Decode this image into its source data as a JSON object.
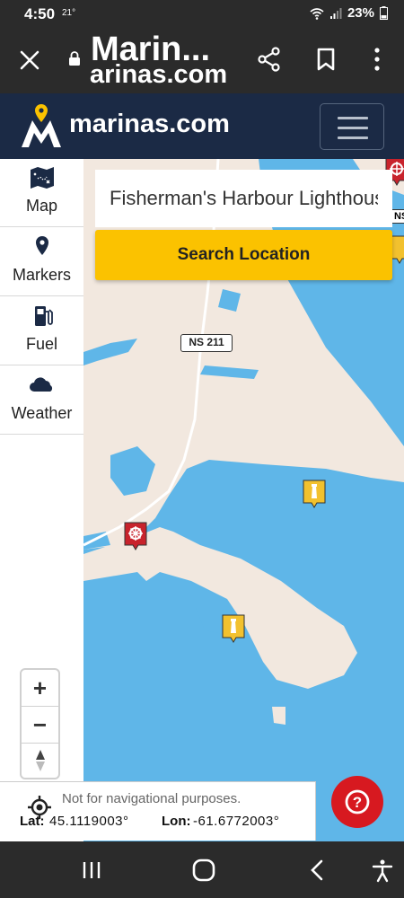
{
  "status_bar": {
    "time": "4:50",
    "temperature": "21°",
    "battery": "23%",
    "icons": [
      "wifi-icon",
      "signal-icon",
      "battery-icon"
    ]
  },
  "browser": {
    "title": "Marin...",
    "url": "arinas.com",
    "icons": [
      "close-icon",
      "lock-icon",
      "share-icon",
      "bookmark-icon",
      "more-vert-icon"
    ]
  },
  "header": {
    "logo_text": "marinas.com",
    "logo_accent": "#fbc200",
    "background": "#1b2a45"
  },
  "sidebar": {
    "items": [
      {
        "label": "Map",
        "icon": "map-icon"
      },
      {
        "label": "Markers",
        "icon": "location-pin-icon"
      },
      {
        "label": "Fuel",
        "icon": "fuel-pump-icon"
      },
      {
        "label": "Weather",
        "icon": "cloud-icon"
      }
    ]
  },
  "search": {
    "value": "Fisherman's Harbour Lighthouse",
    "button_label": "Search Location",
    "button_color": "#fbc200"
  },
  "map": {
    "road_label": "NS 211",
    "water_color": "#5fb6e8",
    "land_color": "#f2e8df",
    "markers": [
      {
        "type": "lighthouse",
        "icon": "lighthouse-icon",
        "color": "#f2c12e"
      },
      {
        "type": "lighthouse",
        "icon": "lighthouse-icon",
        "color": "#f2c12e"
      },
      {
        "type": "marina",
        "icon": "ship-wheel-icon",
        "color": "#c8232c"
      },
      {
        "type": "marina",
        "icon": "ship-wheel-icon",
        "color": "#c8232c"
      },
      {
        "type": "lighthouse",
        "icon": "lighthouse-icon",
        "color": "#f2c12e"
      }
    ],
    "edge_label": "NS"
  },
  "zoom": {
    "zoom_in": "+",
    "zoom_out": "−"
  },
  "footer": {
    "disclaimer": "Not for navigational purposes.",
    "lat_label": "Lat:",
    "lat_value": "45.1119003°",
    "lon_label": "Lon:",
    "lon_value": "-61.6772003°"
  },
  "help": {
    "label": "?",
    "color": "#d71920"
  },
  "nav_bar": {
    "icons": [
      "recent-apps-icon",
      "home-icon",
      "back-icon",
      "accessibility-icon"
    ]
  }
}
